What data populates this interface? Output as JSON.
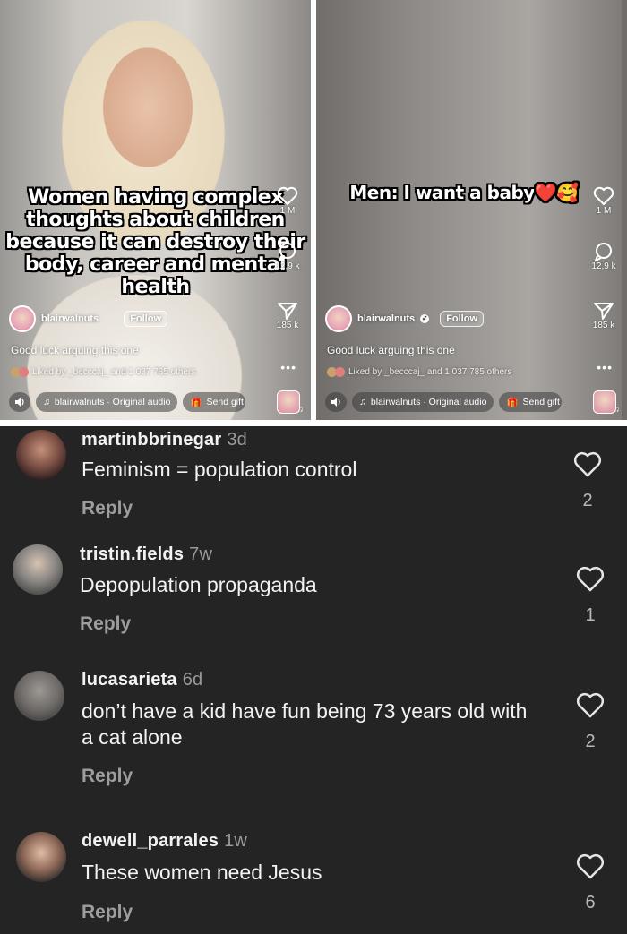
{
  "left_video": {
    "caption_lines": [
      "Women having complex",
      "thoughts about children",
      "because it can destroy their",
      "body, career and mental",
      "health"
    ],
    "likes": "1 M",
    "comments": "12,9 k",
    "shares": "185 k",
    "username": "blairwalnuts",
    "follow_label": "Follow",
    "description": "Good luck arguing this one",
    "liked_by": "Liked by _becccaj_ and 1 037 785 others",
    "audio": "blairwalnuts · Original audio",
    "send_gift": "Send gift"
  },
  "right_video": {
    "caption": "Men: I want a baby",
    "caption_emoji": "❤️🥰",
    "likes": "1 M",
    "comments": "12,9 k",
    "shares": "185 k",
    "username": "blairwalnuts",
    "follow_label": "Follow",
    "description": "Good luck arguing this one",
    "liked_by": "Liked by _becccaj_ and 1 037 785 others",
    "audio": "blairwalnuts · Original audio",
    "send_gift": "Send gift"
  },
  "comments": [
    {
      "username": "martinbbrinegar",
      "ago": "3d",
      "text": "Feminism = population control",
      "reply": "Reply",
      "likes": "2"
    },
    {
      "username": "tristin.fields",
      "ago": "7w",
      "text": "Depopulation propaganda",
      "reply": "Reply",
      "likes": "1"
    },
    {
      "username": "lucasarieta",
      "ago": "6d",
      "text": "don’t have a kid have fun being 73 years old with a cat alone",
      "reply": "Reply",
      "likes": "2"
    },
    {
      "username": "dewell_parrales",
      "ago": "1w",
      "text": "These women need Jesus",
      "reply": "Reply",
      "likes": "6"
    }
  ],
  "colors": {
    "comments_bg": "#242424",
    "text": "#f2f2f2",
    "muted": "#9d9d9d"
  }
}
